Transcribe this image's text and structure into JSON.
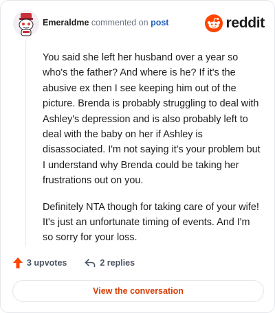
{
  "comment": {
    "username": "Emeraldme",
    "action_text": "commented on",
    "post_link_label": "post",
    "paragraphs": [
      "You said she left her husband over a year so who's the father? And where is he? If it's the abusive ex then I see keeping him out of the picture. Brenda is probably struggling to deal with Ashley's depression and is also probably left to deal with the baby on her if Ashley is disassociated. I'm not saying it's your problem but I understand why Brenda could be taking her frustrations out on you.",
      "Definitely NTA though for taking care of your wife! It's just an unfortunate timing of events. And I'm so sorry for your loss."
    ],
    "upvotes_label": "3 upvotes",
    "replies_label": "2 replies"
  },
  "brand": {
    "wordmark": "reddit",
    "color": "#ff4500",
    "icon": "reddit-logo-icon"
  },
  "footer": {
    "view_button_label": "View the conversation",
    "accent_color": "#d93a00"
  }
}
